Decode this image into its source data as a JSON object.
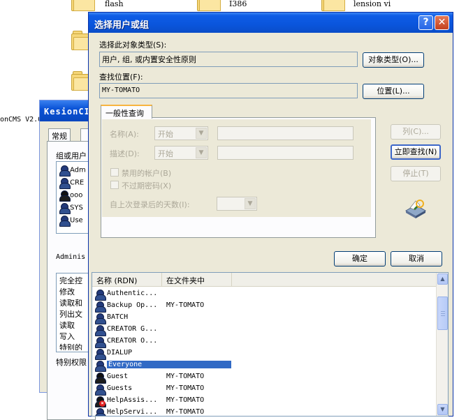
{
  "desktop": {
    "folders": [
      {
        "name": "flash"
      },
      {
        "name": "I386"
      },
      {
        "name": "lension vi"
      }
    ],
    "edge_text": "onCMS V2.0"
  },
  "background_window": {
    "title": "KesionCI",
    "tab_label": "常规",
    "group_label": "组或用户",
    "users": [
      "Adm",
      "CRE",
      "ooo",
      "SYS",
      "Use"
    ],
    "admin_label": "Adminis",
    "perms": [
      "完全控",
      "修改",
      "读取和",
      "列出文",
      "读取",
      "写入",
      "特别的"
    ],
    "special_label": "特别权限"
  },
  "dialog": {
    "title": "选择用户或组",
    "object_type_label": "选择此对象类型(S):",
    "object_type_value": "用户, 组, 或内置安全性原则",
    "object_type_button": "对象类型(O)...",
    "location_label": "查找位置(F):",
    "location_value": "MY-TOMATO",
    "location_button": "位置(L)...",
    "tab_label": "一般性查询",
    "name_label": "名称(A):",
    "name_mode": "开始",
    "desc_label": "描述(D):",
    "desc_mode": "开始",
    "disabled_accounts": "禁用的帐户(B)",
    "no_expire_password": "不过期密码(X)",
    "days_since_login": "自上次登录后的天数(I):",
    "columns_button": "列(C)...",
    "find_now_button": "立即查找(N)",
    "stop_button": "停止(T)",
    "ok_button": "确定",
    "cancel_button": "取消"
  },
  "results": {
    "columns": [
      "名称 (RDN)",
      "在文件夹中"
    ],
    "rows": [
      {
        "name": "Authentic...",
        "folder": ""
      },
      {
        "name": "Backup Op...",
        "folder": "MY-TOMATO"
      },
      {
        "name": "BATCH",
        "folder": ""
      },
      {
        "name": "CREATOR G...",
        "folder": ""
      },
      {
        "name": "CREATOR O...",
        "folder": ""
      },
      {
        "name": "DIALUP",
        "folder": ""
      },
      {
        "name": "Everyone",
        "folder": "",
        "selected": true
      },
      {
        "name": "Guest",
        "folder": "MY-TOMATO"
      },
      {
        "name": "Guests",
        "folder": "MY-TOMATO"
      },
      {
        "name": "HelpAssis...",
        "folder": "MY-TOMATO"
      },
      {
        "name": "HelpServi...",
        "folder": "MY-TOMATO"
      }
    ]
  },
  "icons": {
    "help": "question-icon",
    "close": "close-icon",
    "scroll_up": "arrow-up-icon",
    "scroll_down": "arrow-down-icon",
    "dropdown": "chevron-down-icon",
    "search_illustration": "printer-search-icon",
    "user_group": "user-group-icon",
    "user": "user-icon"
  },
  "colors": {
    "title_bar": "#0a55dc",
    "selection": "#316ac5",
    "dialog_bg": "#ece9d8",
    "tab_accent": "#f7b43f"
  }
}
